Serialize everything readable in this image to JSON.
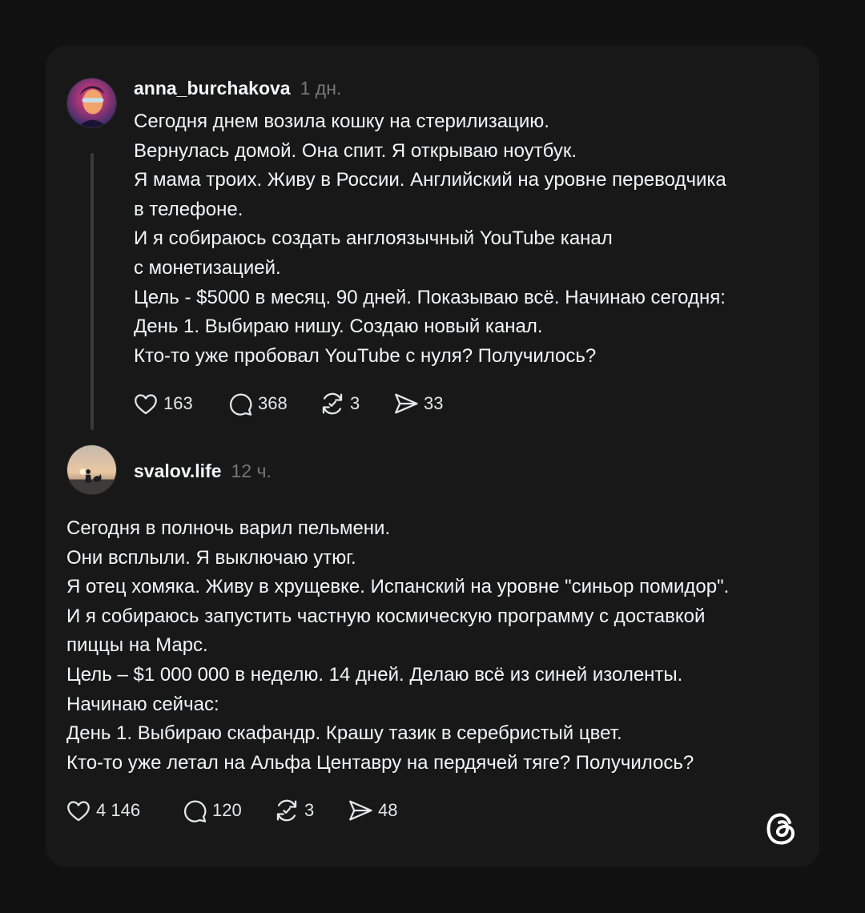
{
  "posts": [
    {
      "username": "anna_burchakova",
      "time": "1 дн.",
      "lines": [
        "Сегодня днем возила кошку на стерилизацию.",
        "Вернулась домой. Она спит. Я открываю ноутбук.",
        "Я мама троих. Живу в России. Английский на уровне переводчика",
        "в телефоне.",
        "И я собираюсь создать англоязычный YouTube канал",
        "с монетизацией.",
        "Цель - $5000 в месяц. 90 дней. Показываю всё. Начинаю сегодня:",
        "День 1. Выбираю нишу. Создаю новый канал.",
        "Кто-то уже пробовал YouTube с нуля? Получилось?"
      ],
      "stats": {
        "likes": "163",
        "comments": "368",
        "reposts": "3",
        "shares": "33"
      }
    },
    {
      "username": "svalov.life",
      "time": "12 ч.",
      "lines": [
        "Сегодня в полночь варил пельмени.",
        "Они всплыли. Я выключаю утюг.",
        "Я отец хомяка. Живу в хрущевке. Испанский на уровне \"синьор помидор\".",
        "И я собираюсь запустить частную космическую программу с доставкой",
        "пиццы на Марс.",
        "Цель – $1 000 000 в неделю. 14 дней. Делаю всё из синей изоленты.",
        "Начинаю сейчас:",
        "День 1. Выбираю скафандр. Крашу тазик в серебристый цвет.",
        "Кто-то уже летал на Альфа Центавру на пердячей тяге? Получилось?"
      ],
      "stats": {
        "likes": "4 146",
        "comments": "120",
        "reposts": "3",
        "shares": "48"
      }
    }
  ],
  "icons": {
    "like": "heart-icon",
    "comment": "comment-bubble-icon",
    "repost": "repost-icon",
    "share": "share-send-icon",
    "brand": "threads-logo-icon"
  },
  "colors": {
    "background": "#111111",
    "card": "#181818",
    "text": "#f3f5f7",
    "muted": "#777777",
    "thread_line": "#3a3a3a"
  }
}
